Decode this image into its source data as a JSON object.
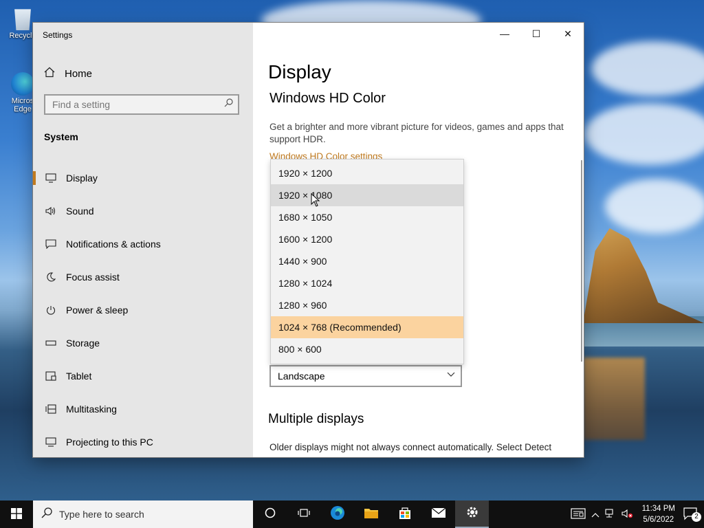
{
  "desktop": {
    "icons": [
      {
        "label": "Recycle"
      },
      {
        "label": "Micros Edge"
      }
    ]
  },
  "window": {
    "title": "Settings",
    "minimize_glyph": "—",
    "maximize_glyph": "☐",
    "close_glyph": "✕"
  },
  "sidebar": {
    "home_label": "Home",
    "search_placeholder": "Find a setting",
    "section_title": "System",
    "items": [
      {
        "label": "Display",
        "icon": "monitor-icon",
        "active": true
      },
      {
        "label": "Sound",
        "icon": "speaker-icon"
      },
      {
        "label": "Notifications & actions",
        "icon": "message-icon"
      },
      {
        "label": "Focus assist",
        "icon": "moon-icon"
      },
      {
        "label": "Power & sleep",
        "icon": "power-icon"
      },
      {
        "label": "Storage",
        "icon": "storage-icon"
      },
      {
        "label": "Tablet",
        "icon": "tablet-icon"
      },
      {
        "label": "Multitasking",
        "icon": "multitasking-icon"
      },
      {
        "label": "Projecting to this PC",
        "icon": "projecting-icon"
      }
    ]
  },
  "content": {
    "page_title": "Display",
    "hdr_title": "Windows HD Color",
    "hdr_description": "Get a brighter and more vibrant picture for videos, games and apps that support HDR.",
    "hdr_link": "Windows HD Color settings",
    "orientation_value": "Landscape",
    "multiple_displays_title": "Multiple displays",
    "multiple_displays_desc": "Older displays might not always connect automatically. Select Detect"
  },
  "resolution_popup": {
    "options": [
      "1920 × 1200",
      "1920 × 1080",
      "1680 × 1050",
      "1600 × 1200",
      "1440 × 900",
      "1280 × 1024",
      "1280 × 960",
      "1024 × 768 (Recommended)",
      "800 × 600"
    ],
    "hovered": "1920 × 1080",
    "selected": "1024 × 768 (Recommended)"
  },
  "taskbar": {
    "search_placeholder": "Type here to search",
    "time": "11:34 PM",
    "date": "5/6/2022",
    "notification_count": "2"
  },
  "colors": {
    "accent": "#c07a1f",
    "selected_option": "#fbd39f",
    "sidebar_bg": "#e6e6e6",
    "taskbar_bg": "#101010"
  }
}
